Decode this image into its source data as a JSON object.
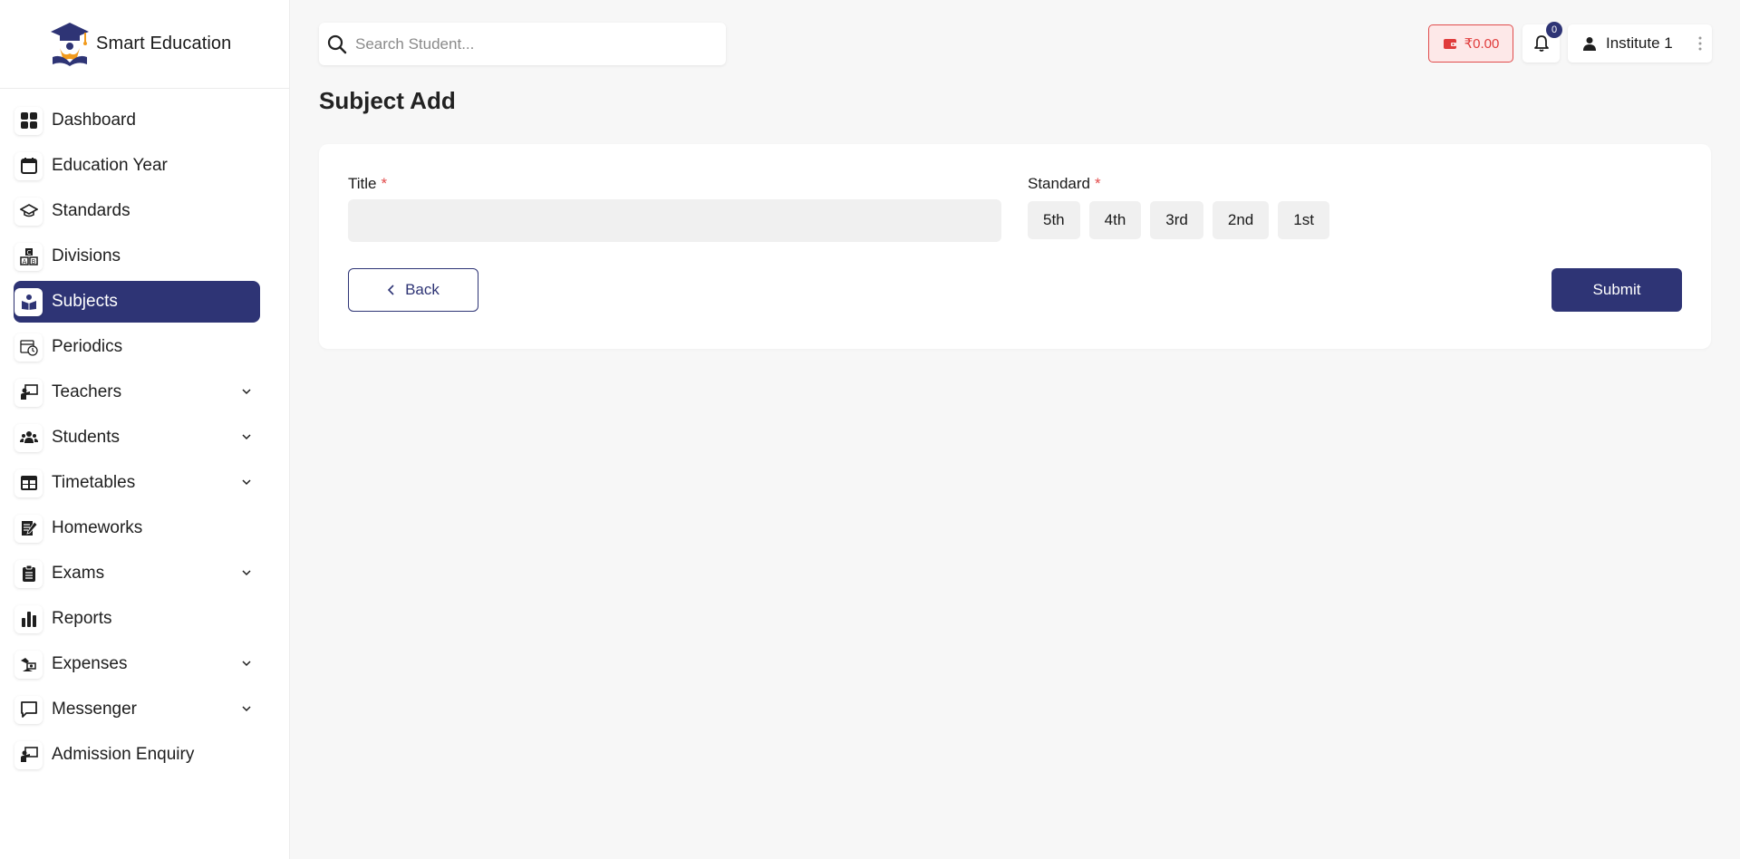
{
  "brand": {
    "name": "Smart Education",
    "logo_icon": "graduation-cap-logo"
  },
  "sidebar": {
    "items": [
      {
        "label": "Dashboard",
        "icon": "dashboard-grid-icon",
        "active": false,
        "expandable": false
      },
      {
        "label": "Education Year",
        "icon": "calendar-icon",
        "active": false,
        "expandable": false
      },
      {
        "label": "Standards",
        "icon": "graduation-cap-icon",
        "active": false,
        "expandable": false
      },
      {
        "label": "Divisions",
        "icon": "abc-blocks-icon",
        "active": false,
        "expandable": false
      },
      {
        "label": "Subjects",
        "icon": "book-reader-icon",
        "active": true,
        "expandable": false
      },
      {
        "label": "Periodics",
        "icon": "calendar-clock-icon",
        "active": false,
        "expandable": false
      },
      {
        "label": "Teachers",
        "icon": "teacher-board-icon",
        "active": false,
        "expandable": true
      },
      {
        "label": "Students",
        "icon": "users-icon",
        "active": false,
        "expandable": true
      },
      {
        "label": "Timetables",
        "icon": "table-icon",
        "active": false,
        "expandable": true
      },
      {
        "label": "Homeworks",
        "icon": "homework-pencil-icon",
        "active": false,
        "expandable": false
      },
      {
        "label": "Exams",
        "icon": "clipboard-icon",
        "active": false,
        "expandable": true
      },
      {
        "label": "Reports",
        "icon": "bar-chart-icon",
        "active": false,
        "expandable": false
      },
      {
        "label": "Expenses",
        "icon": "hand-money-icon",
        "active": false,
        "expandable": true
      },
      {
        "label": "Messenger",
        "icon": "message-icon",
        "active": false,
        "expandable": true
      },
      {
        "label": "Admission Enquiry",
        "icon": "teacher-board-icon",
        "active": false,
        "expandable": false
      }
    ]
  },
  "header": {
    "search": {
      "placeholder": "Search Student...",
      "value": ""
    },
    "wallet": {
      "amount": "₹0.00"
    },
    "notifications": {
      "count": "0"
    },
    "user": {
      "name": "Institute 1"
    }
  },
  "page": {
    "title": "Subject Add"
  },
  "form": {
    "title_label": "Title",
    "title_value": "",
    "standard_label": "Standard",
    "required_mark": "*",
    "standards": [
      "5th",
      "4th",
      "3rd",
      "2nd",
      "1st"
    ],
    "back_label": "Back",
    "submit_label": "Submit"
  },
  "colors": {
    "accent": "#2e3475",
    "wallet_red": "#e03b3b",
    "wallet_bg": "#fde8e8",
    "required": "#e24b4b"
  }
}
